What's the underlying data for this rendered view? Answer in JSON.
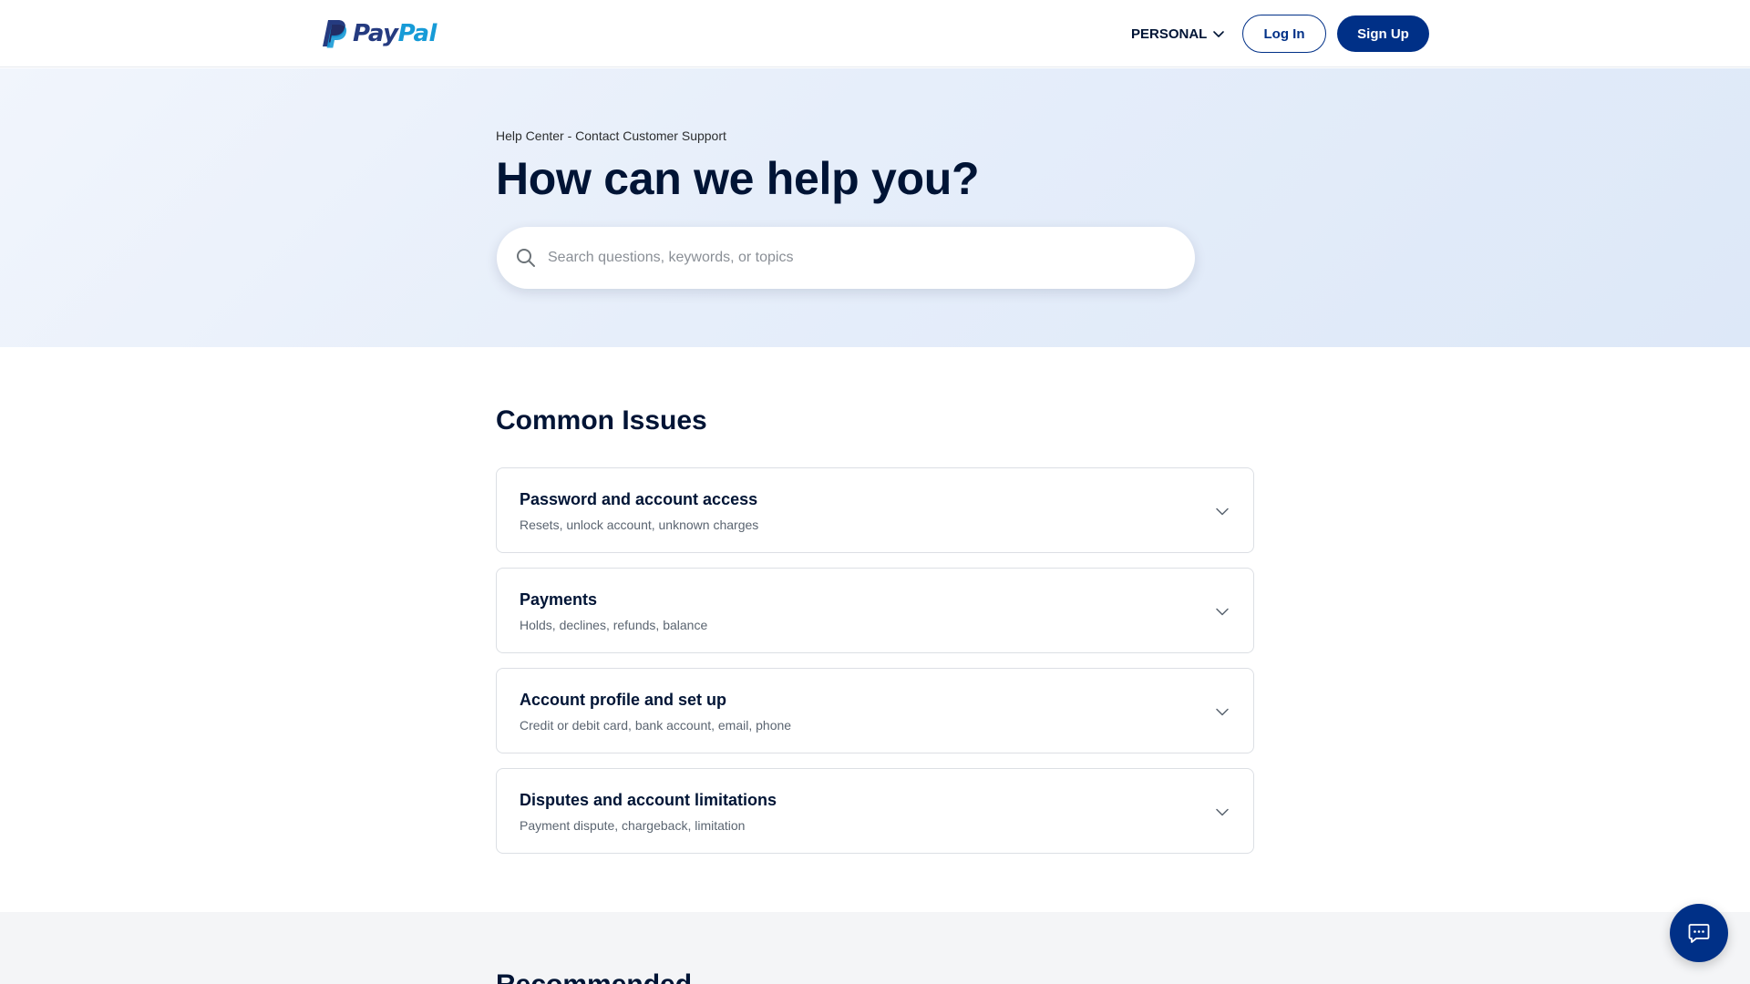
{
  "header": {
    "logo": {
      "part1": "Pay",
      "part2": "Pal"
    },
    "nav": {
      "personal_label": "PERSONAL"
    },
    "login_label": "Log In",
    "signup_label": "Sign Up"
  },
  "hero": {
    "breadcrumb": "Help Center - Contact Customer Support",
    "title": "How can we help you?",
    "search": {
      "placeholder": "Search questions, keywords, or topics",
      "value": ""
    }
  },
  "common_issues": {
    "title": "Common Issues",
    "items": [
      {
        "title": "Password and account access",
        "subtitle": "Resets, unlock account, unknown charges"
      },
      {
        "title": "Payments",
        "subtitle": "Holds, declines, refunds, balance"
      },
      {
        "title": "Account profile and set up",
        "subtitle": "Credit or debit card, bank account, email, phone"
      },
      {
        "title": "Disputes and account limitations",
        "subtitle": "Payment dispute, chargeback, limitation"
      }
    ]
  },
  "recommended": {
    "title": "Recommended"
  },
  "colors": {
    "brand_navy": "#003087",
    "brand_dark_blue": "#253b80",
    "brand_light_blue": "#179bd7",
    "text_primary": "#001435"
  },
  "icons": {
    "logo": "paypal-p-icon",
    "dropdown": "chevron-down-icon",
    "search": "search-icon",
    "expand": "chevron-down-icon",
    "chat": "chat-bubble-icon"
  }
}
